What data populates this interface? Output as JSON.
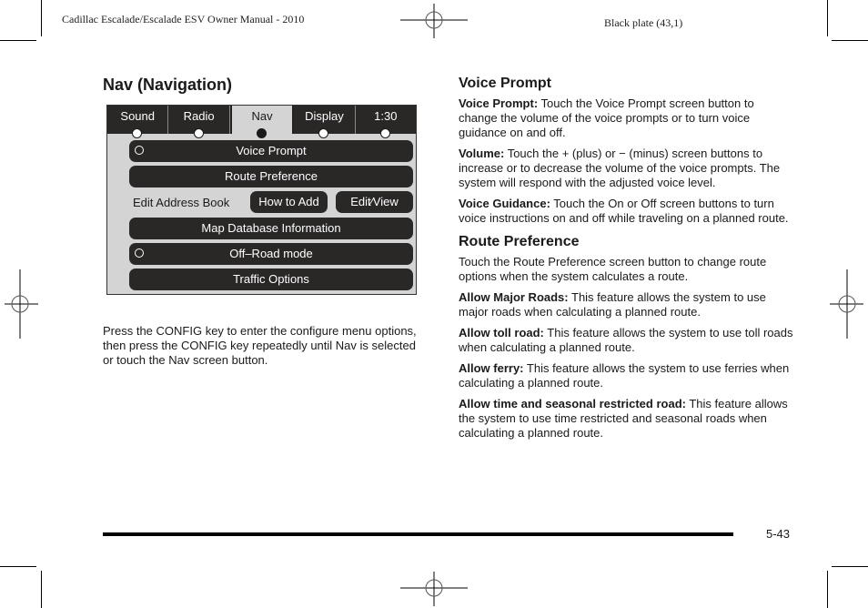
{
  "header": {
    "manual_title": "Cadillac Escalade/Escalade ESV Owner Manual - 2010",
    "plate": "Black plate (43,1)"
  },
  "left": {
    "section_title": "Nav (Navigation)",
    "screen": {
      "tabs": [
        {
          "label": "Sound",
          "active": false
        },
        {
          "label": "Radio",
          "active": false
        },
        {
          "label": "Nav",
          "active": true
        },
        {
          "label": "Display",
          "active": false
        },
        {
          "label": "1:30",
          "active": false
        }
      ],
      "buttons": {
        "voice_prompt": "Voice Prompt",
        "route_preference": "Route Preference",
        "edit_address_book_label": "Edit Address Book",
        "how_to_add": "How to Add",
        "edit_view": "Edit∕View",
        "map_database": "Map Database Information",
        "off_road": "Off–Road mode",
        "traffic_options": "Traffic Options"
      },
      "colors": {
        "button_fill": "#2a2727",
        "screen_bg": "#dcdcdc"
      }
    },
    "intro_text": "Press the CONFIG key to enter the configure menu options, then press the CONFIG key repeatedly until Nav is selected or touch the Nav screen button."
  },
  "right": {
    "voice_prompt": {
      "heading": "Voice Prompt",
      "items": [
        {
          "term": "Voice Prompt:",
          "text": " Touch the Voice Prompt screen button to change the volume of the voice prompts or to turn voice guidance on and off."
        },
        {
          "term": "Volume:",
          "text": " Touch the + (plus) or − (minus) screen buttons to increase or to decrease the volume of the voice prompts. The system will respond with the adjusted voice level."
        },
        {
          "term": "Voice Guidance:",
          "text": " Touch the On or Off screen buttons to turn voice instructions on and off while traveling on a planned route."
        }
      ]
    },
    "route_preference": {
      "heading": "Route Preference",
      "intro": "Touch the Route Preference screen button to change route options when the system calculates a route.",
      "items": [
        {
          "term": "Allow Major Roads:",
          "text": " This feature allows the system to use major roads when calculating a planned route."
        },
        {
          "term": "Allow toll road:",
          "text": " This feature allows the system to use toll roads when calculating a planned route."
        },
        {
          "term": "Allow ferry:",
          "text": " This feature allows the system to use ferries when calculating a planned route."
        },
        {
          "term": "Allow time and seasonal restricted road:",
          "text": " This feature allows the system to use time restricted and seasonal roads when calculating a planned route."
        }
      ]
    }
  },
  "footer": {
    "page_number": "5-43"
  }
}
